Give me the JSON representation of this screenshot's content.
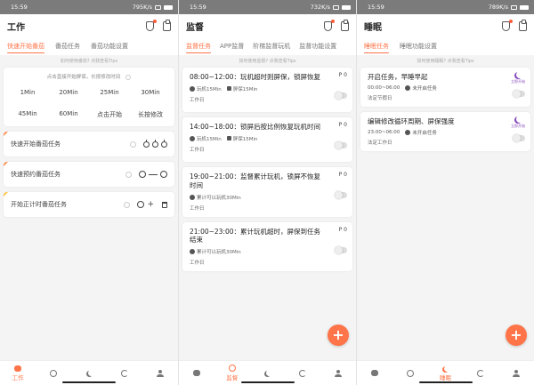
{
  "status_bars": [
    {
      "time": "15:59",
      "speed": "795K/s",
      "battery": "⚡"
    },
    {
      "time": "15:59",
      "speed": "732K/s",
      "battery": "⚡"
    },
    {
      "time": "15:59",
      "speed": "789K/s",
      "battery": "⚡"
    }
  ],
  "work": {
    "title": "工作",
    "tabs": [
      "快速开始番茄",
      "番茄任务",
      "番茄功能设置"
    ],
    "hint": "如何使用番茄? 点我查看Tips",
    "quick_title": "点击直接开始屏保，长按修改时间",
    "quick_items": [
      "1Min",
      "20Min",
      "25Min",
      "30Min",
      "45Min",
      "60Min",
      "点击开始",
      "长按修改"
    ],
    "tasks": [
      {
        "label": "快速开始番茄任务",
        "icons": "apple-icons"
      },
      {
        "label": "快速预约番茄任务",
        "icons": "clock-range"
      },
      {
        "label": "开始正计时番茄任务",
        "icons": "clock-add-delete"
      }
    ]
  },
  "supervise": {
    "title": "监督",
    "tabs": [
      "监督任务",
      "APP监督",
      "阶梯监督玩机",
      "监督功能设置"
    ],
    "hint": "如何使用监督? 点我查看Tips",
    "cards": [
      {
        "title": "08:00~12:00：玩机超时则屏保，锁屏恢复",
        "count": "P 0",
        "meta1": "玩机15Min",
        "meta2": "屏保15Min",
        "sub": "工作日"
      },
      {
        "title": "14:00~18:00：锁屏后按比例恢复玩机时间",
        "count": "P 0",
        "meta1": "玩机15Min",
        "meta2": "屏保15Min",
        "sub": "工作日"
      },
      {
        "title": "19:00~21:00：监督累计玩机，锁屏不恢复时间",
        "count": "P 0",
        "meta1": "累计可以玩机30Min",
        "meta2": "",
        "sub": "工作日"
      },
      {
        "title": "21:00~23:00：累计玩机超时，屏保到任务结束",
        "count": "P 0",
        "meta1": "累计可以玩机30Min",
        "meta2": "",
        "sub": "工作日"
      }
    ],
    "fab": "+"
  },
  "sleep": {
    "title": "睡眠",
    "tabs": [
      "睡眠任务",
      "睡眠功能设置"
    ],
    "hint": "如何使用睡眠? 点我查看Tips",
    "cards": [
      {
        "title": "开启任务，早睡早起",
        "time": "00:00~06:00",
        "status": "未开启任务",
        "sub": "法定节假日",
        "badge": "立即开始"
      },
      {
        "title": "编辑修改循环周期、屏保强度",
        "time": "23:00~06:00",
        "status": "未开启任务",
        "sub": "法定工作日",
        "badge": "立即开始"
      }
    ],
    "fab": "+"
  },
  "nav": {
    "work_label": "工作",
    "supervise_label": "监督",
    "sleep_label": "睡眠"
  },
  "colors": {
    "accent": "#ff7448",
    "sleep_purple": "#8a4fbf",
    "status_bar": "#7b7b7b"
  }
}
